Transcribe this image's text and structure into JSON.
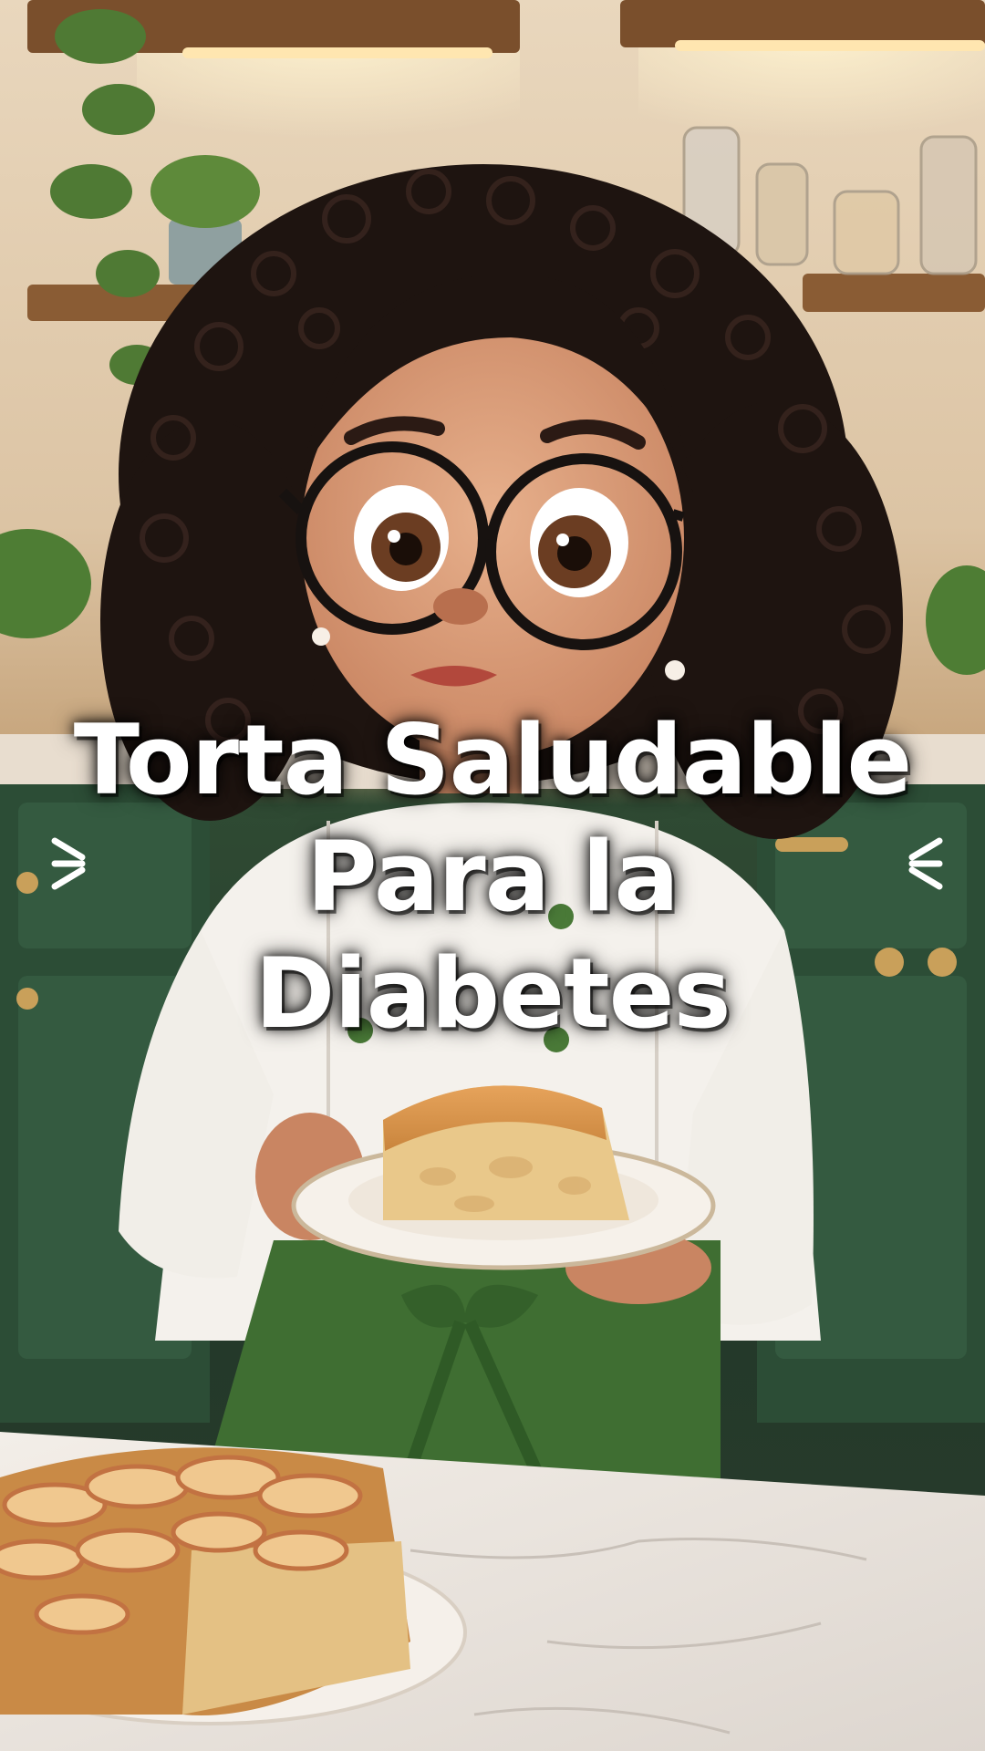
{
  "title": {
    "line1": "Torta Saludable",
    "line2": "Para la",
    "line3": "Diabetes"
  },
  "colors": {
    "title_text": "#ffffff",
    "title_glow": "#000000",
    "apron": "#3f6e32",
    "cabinets": "#2a4a33",
    "chef_coat": "#f4f1ec"
  },
  "decorations": {
    "left": "burst-lines-icon",
    "right": "burst-lines-icon"
  }
}
